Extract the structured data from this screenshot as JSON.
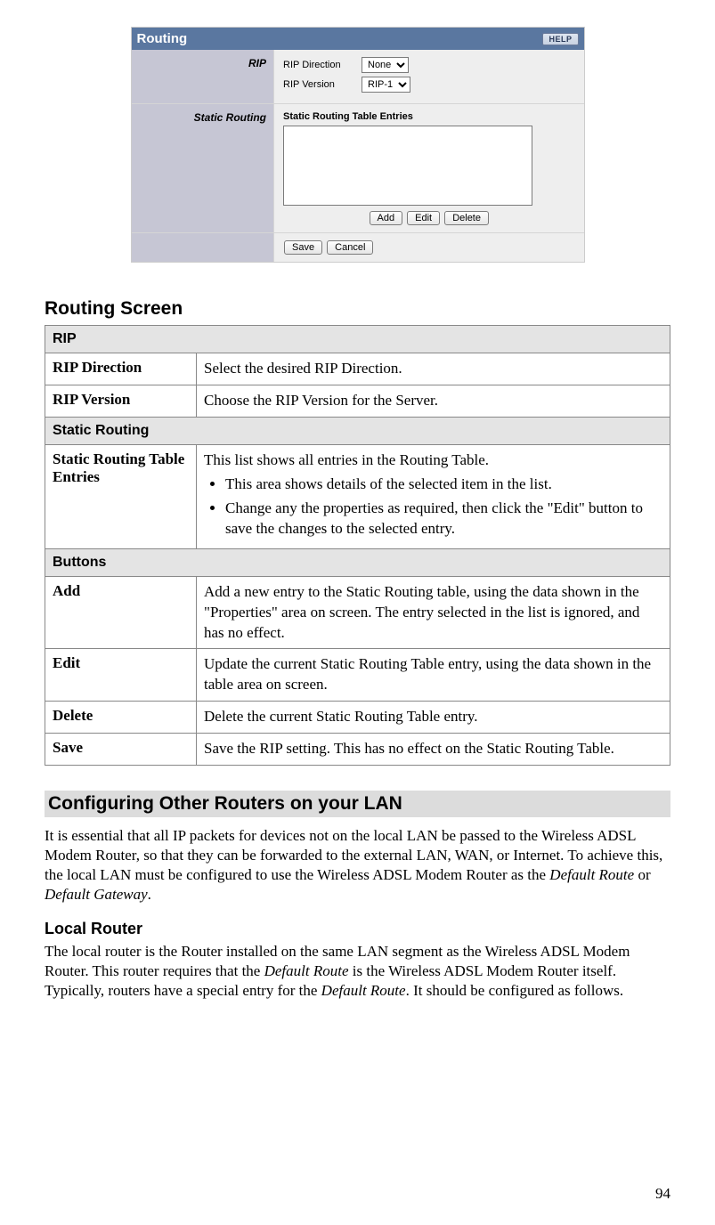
{
  "page_number": "94",
  "screenshot": {
    "title": "Routing",
    "help_label": "HELP",
    "rip_section_label": "RIP",
    "rip_direction_label": "RIP Direction",
    "rip_direction_value": "None",
    "rip_version_label": "RIP Version",
    "rip_version_value": "RIP-1",
    "static_routing_label": "Static Routing",
    "sr_caption": "Static Routing Table Entries",
    "buttons": {
      "add": "Add",
      "edit": "Edit",
      "delete": "Delete",
      "save": "Save",
      "cancel": "Cancel"
    }
  },
  "routing_screen_heading": "Routing Screen",
  "table": {
    "rip_header": "RIP",
    "rip_direction_label": "RIP Direction",
    "rip_direction_desc": "Select the desired RIP Direction.",
    "rip_version_label": "RIP Version",
    "rip_version_desc": "Choose the RIP Version for the Server.",
    "static_routing_header": "Static Routing",
    "srte_label": "Static Routing Table Entries",
    "srte_intro": "This list shows all entries in the Routing Table.",
    "srte_b1": "This area shows details of the selected item in the list.",
    "srte_b2": "Change any the properties as required, then click the \"Edit\" button to save the changes to the selected entry.",
    "buttons_header": "Buttons",
    "add_label": "Add",
    "add_desc": "Add a new entry to the Static Routing table, using the data shown in the \"Properties\" area on screen. The entry selected in the list is ignored, and has no effect.",
    "edit_label": "Edit",
    "edit_desc": "Update the current Static Routing Table entry, using the data shown in the table area on screen.",
    "delete_label": "Delete",
    "delete_desc": "Delete the current Static Routing Table entry.",
    "save_label": "Save",
    "save_desc": "Save the RIP setting. This has no effect on the Static Routing Table."
  },
  "config_heading": "Configuring Other Routers on your LAN",
  "config_para_1a": "It is essential that all IP packets for devices not on the local LAN be passed to the Wireless ADSL Modem Router, so that they can be forwarded to the external LAN, WAN, or Internet. To achieve this, the local LAN must be configured to use the Wireless ADSL Modem Router as the ",
  "config_para_1b": "Default Route",
  "config_para_1c": " or ",
  "config_para_1d": "Default Gateway",
  "config_para_1e": ".",
  "local_router_heading": "Local Router",
  "local_para_1a": "The local router is the Router installed on the same LAN segment as the Wireless ADSL Modem Router. This router requires that the ",
  "local_para_1b": "Default Route",
  "local_para_1c": " is the Wireless ADSL Modem Router itself. Typically, routers have a special entry for the ",
  "local_para_1d": "Default Route",
  "local_para_1e": ". It should be configured as follows."
}
